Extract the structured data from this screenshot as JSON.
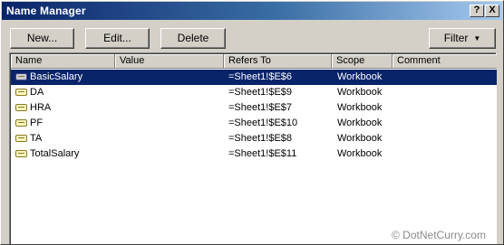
{
  "window": {
    "title": "Name Manager",
    "help_label": "?",
    "close_label": "X"
  },
  "toolbar": {
    "new_label": "New...",
    "edit_label": "Edit...",
    "delete_label": "Delete",
    "filter_label": "Filter",
    "filter_caret": "▼"
  },
  "columns": [
    "Name",
    "Value",
    "Refers To",
    "Scope",
    "Comment"
  ],
  "rows": [
    {
      "name": "BasicSalary",
      "value": "",
      "refers_to": "=Sheet1!$E$6",
      "scope": "Workbook",
      "comment": "",
      "selected": true
    },
    {
      "name": "DA",
      "value": "",
      "refers_to": "=Sheet1!$E$9",
      "scope": "Workbook",
      "comment": ""
    },
    {
      "name": "HRA",
      "value": "",
      "refers_to": "=Sheet1!$E$7",
      "scope": "Workbook",
      "comment": ""
    },
    {
      "name": "PF",
      "value": "",
      "refers_to": "=Sheet1!$E$10",
      "scope": "Workbook",
      "comment": ""
    },
    {
      "name": "TA",
      "value": "",
      "refers_to": "=Sheet1!$E$8",
      "scope": "Workbook",
      "comment": ""
    },
    {
      "name": "TotalSalary",
      "value": "",
      "refers_to": "=Sheet1!$E$11",
      "scope": "Workbook",
      "comment": ""
    }
  ],
  "watermark": "© DotNetCurry.com",
  "colors": {
    "selection": "#0a246a",
    "title_start": "#0a246a",
    "title_end": "#a6caf0",
    "face": "#d4d0c8"
  }
}
